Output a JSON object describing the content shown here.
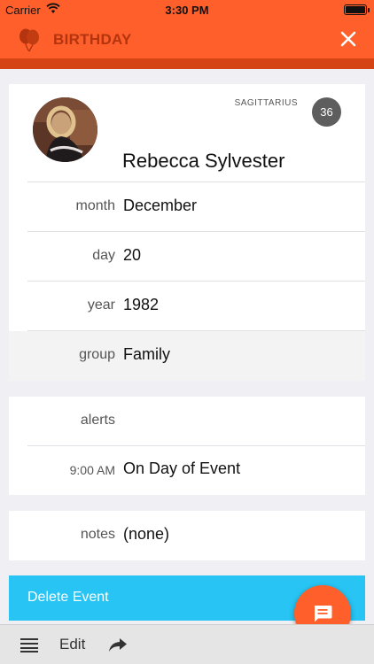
{
  "status_bar": {
    "carrier": "Carrier",
    "time": "3:30 PM"
  },
  "nav": {
    "title": "BIRTHDAY",
    "icon": "balloons-icon",
    "close_icon": "close-icon"
  },
  "colors": {
    "accent": "#ff5f2a",
    "title_text": "#b3340f",
    "delete_bg": "#27c4f4",
    "badge_bg": "#5e5e5e"
  },
  "contact": {
    "name": "Rebecca Sylvester",
    "zodiac": "SAGITTARIUS",
    "age": "36"
  },
  "fields": {
    "month": {
      "label": "month",
      "value": "December"
    },
    "day": {
      "label": "day",
      "value": "20"
    },
    "year": {
      "label": "year",
      "value": "1982"
    },
    "group": {
      "label": "group",
      "value": "Family"
    }
  },
  "alerts": {
    "label": "alerts",
    "items": [
      {
        "time": "9:00 AM",
        "text": "On Day of Event"
      }
    ]
  },
  "notes": {
    "label": "notes",
    "value": "(none)"
  },
  "actions": {
    "delete_label": "Delete Event",
    "fab_icon": "message-icon"
  },
  "toolbar": {
    "menu_icon": "list-icon",
    "edit_label": "Edit",
    "share_icon": "share-icon"
  }
}
